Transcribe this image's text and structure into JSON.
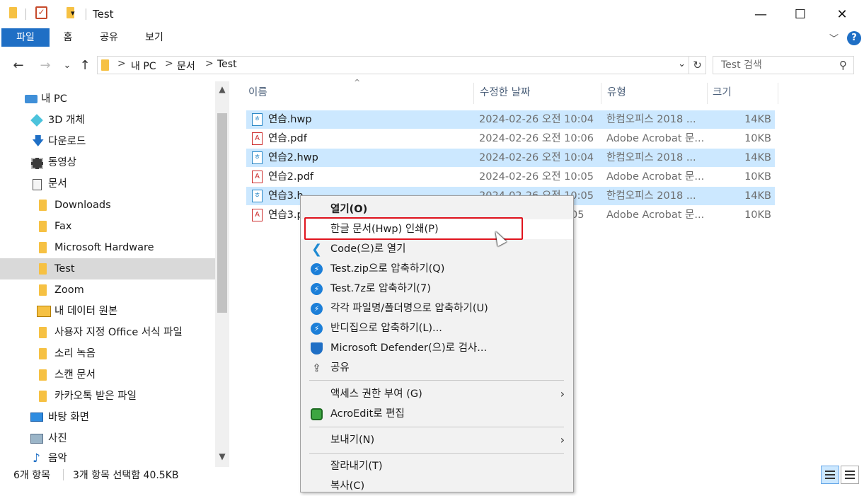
{
  "window": {
    "title": "Test",
    "minimize": "—",
    "maximize": "☐",
    "close": "✕"
  },
  "ribbon": {
    "tabs": [
      "파일",
      "홈",
      "공유",
      "보기"
    ],
    "help": "?",
    "collapse": "﹀"
  },
  "address": {
    "back": "←",
    "forward": "→",
    "recent": "⌄",
    "up": "↑",
    "crumbs": [
      "내 PC",
      "문서",
      "Test"
    ],
    "separator": ">",
    "dropdown": "⌄",
    "refresh": "↻"
  },
  "search": {
    "placeholder": "Test 검색",
    "icon": "⚲"
  },
  "nav": {
    "items": [
      {
        "label": "내 PC",
        "icon": "pc-icon"
      },
      {
        "label": "3D 개체",
        "icon": "3d-objects-icon"
      },
      {
        "label": "다운로드",
        "icon": "download-icon"
      },
      {
        "label": "동영상",
        "icon": "video-icon"
      },
      {
        "label": "문서",
        "icon": "documents-icon"
      },
      {
        "label": "Downloads",
        "icon": "folder-icon"
      },
      {
        "label": "Fax",
        "icon": "folder-icon"
      },
      {
        "label": "Microsoft Hardware",
        "icon": "folder-icon"
      },
      {
        "label": "Test",
        "icon": "folder-icon",
        "selected": true
      },
      {
        "label": "Zoom",
        "icon": "folder-icon"
      },
      {
        "label": "내 데이터 원본",
        "icon": "data-source-icon"
      },
      {
        "label": "사용자 지정 Office 서식 파일",
        "icon": "folder-icon"
      },
      {
        "label": "소리 녹음",
        "icon": "folder-icon"
      },
      {
        "label": "스캔 문서",
        "icon": "folder-icon"
      },
      {
        "label": "카카오톡 받은 파일",
        "icon": "folder-icon"
      },
      {
        "label": "바탕 화면",
        "icon": "desktop-icon"
      },
      {
        "label": "사진",
        "icon": "pictures-icon"
      },
      {
        "label": "음악",
        "icon": "music-icon"
      }
    ],
    "scroll_up": "▲",
    "scroll_down": "▼"
  },
  "columns": {
    "name": "이름",
    "date": "수정한 날짜",
    "type": "유형",
    "size": "크기",
    "sort_indicator": "^"
  },
  "files": [
    {
      "name": "연습.hwp",
      "date": "2024-02-26 오전 10:04",
      "type": "한컴오피스 2018 ...",
      "size": "14KB",
      "kind": "hwp",
      "selected": true
    },
    {
      "name": "연습.pdf",
      "date": "2024-02-26 오전 10:06",
      "type": "Adobe Acrobat 문...",
      "size": "10KB",
      "kind": "pdf",
      "selected": false
    },
    {
      "name": "연습2.hwp",
      "date": "2024-02-26 오전 10:04",
      "type": "한컴오피스 2018 ...",
      "size": "14KB",
      "kind": "hwp",
      "selected": true
    },
    {
      "name": "연습2.pdf",
      "date": "2024-02-26 오전 10:05",
      "type": "Adobe Acrobat 문...",
      "size": "10KB",
      "kind": "pdf",
      "selected": false
    },
    {
      "name": "연습3.h",
      "date": "2024-02-26 오전 10:05",
      "type": "한컴오피스 2018 ...",
      "size": "14KB",
      "kind": "hwp",
      "selected": true
    },
    {
      "name": "연습3.p",
      "date": "05",
      "type": "Adobe Acrobat 문...",
      "size": "10KB",
      "kind": "pdf",
      "selected": false
    }
  ],
  "file_icons": {
    "hwp": "ㅎ",
    "pdf": "A"
  },
  "status": {
    "count": "6개 항목",
    "selection": "3개 항목 선택함 40.5KB"
  },
  "context_menu": {
    "items": [
      {
        "label": "열기(O)",
        "icon": "",
        "bold": true
      },
      {
        "label": "한글 문서(Hwp) 인쇄(P)",
        "icon": "",
        "highlighted": true
      },
      {
        "label": "Code(으)로 열기",
        "icon": "vscode-icon",
        "glyph": "❮"
      },
      {
        "label": "Test.zip으로 압축하기(Q)",
        "icon": "bandizip-icon",
        "glyph": "⚡"
      },
      {
        "label": "Test.7z로 압축하기(7)",
        "icon": "bandizip-icon",
        "glyph": "⚡"
      },
      {
        "label": "각각 파일명/폴더명으로 압축하기(U)",
        "icon": "bandizip-icon",
        "glyph": "⚡"
      },
      {
        "label": "반디집으로 압축하기(L)...",
        "icon": "bandizip-icon",
        "glyph": "⚡"
      },
      {
        "label": "Microsoft Defender(으)로 검사...",
        "icon": "defender-shield-icon",
        "glyph": ""
      },
      {
        "label": "공유",
        "icon": "share-icon",
        "glyph": "⇪"
      },
      {
        "label": "액세스 권한 부여 (G)",
        "icon": "",
        "submenu": true
      },
      {
        "label": "AcroEdit로 편집",
        "icon": "acroedit-icon",
        "glyph": ""
      },
      {
        "label": "보내기(N)",
        "icon": "",
        "submenu": true
      },
      {
        "label": "잘라내기(T)",
        "icon": ""
      },
      {
        "label": "복사(C)",
        "icon": ""
      }
    ],
    "submenu_arrow": "›"
  }
}
